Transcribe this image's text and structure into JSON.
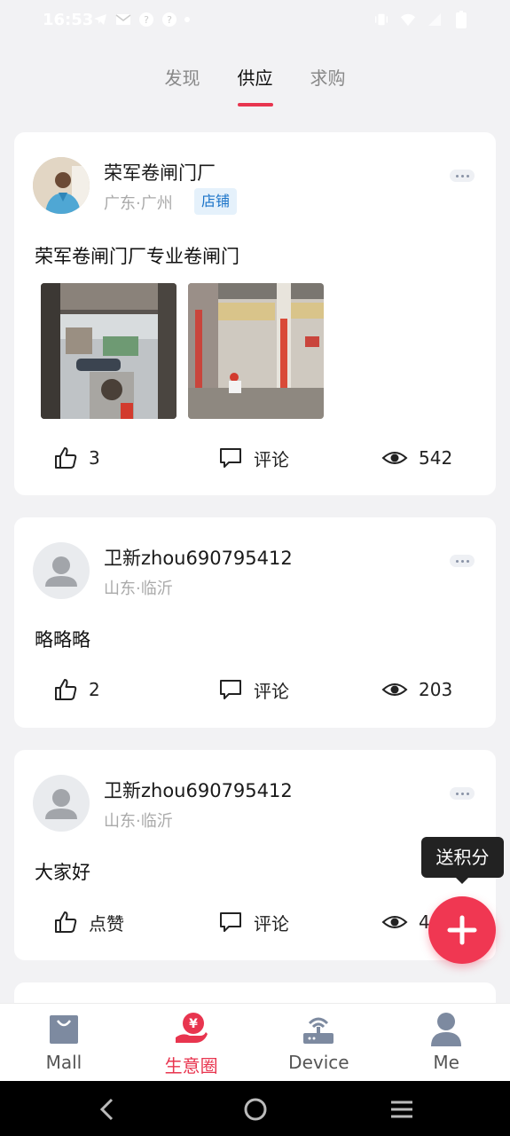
{
  "status_bar": {
    "time": "16:53"
  },
  "tabs": [
    {
      "label": "发现"
    },
    {
      "label": "供应"
    },
    {
      "label": "求购"
    }
  ],
  "active_tab": "供应",
  "posts": [
    {
      "user": "荣军卷闸门厂",
      "location": "广东·广州",
      "badge": "店铺",
      "text": "荣军卷闸门厂专业卷闸门",
      "likes": "3",
      "comment_label": "评论",
      "views": "542"
    },
    {
      "user": "卫新zhou690795412",
      "location": "山东·临沂",
      "text": "略略略",
      "likes": "2",
      "comment_label": "评论",
      "views": "203"
    },
    {
      "user": "卫新zhou690795412",
      "location": "山东·临沂",
      "text": "大家好",
      "likes": "点赞",
      "comment_label": "评论",
      "views": "4"
    }
  ],
  "fab": {
    "tooltip": "送积分"
  },
  "bottom_nav": [
    {
      "label": "Mall",
      "icon": "shopping-bag-icon"
    },
    {
      "label": "生意圈",
      "icon": "yuan-hand-icon"
    },
    {
      "label": "Device",
      "icon": "router-icon"
    },
    {
      "label": "Me",
      "icon": "person-icon"
    }
  ],
  "colors": {
    "accent": "#e8354f",
    "fab": "#f03752",
    "badge_bg": "#e5f1fb",
    "badge_text": "#1a73c8"
  }
}
